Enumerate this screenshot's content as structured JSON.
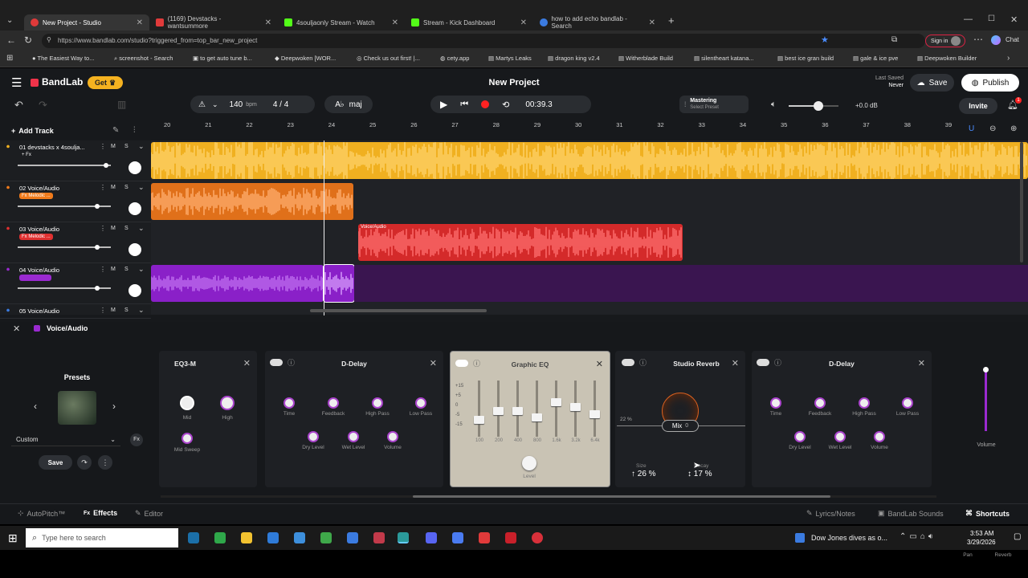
{
  "browser": {
    "tabs": [
      {
        "label": "New Project - Studio",
        "color": "#e03a3a"
      },
      {
        "label": "(1169) Devstacks - wantsummore",
        "color": "#e03a3a"
      },
      {
        "label": "4souljaonly Stream - Watch",
        "color": "#53fc18"
      },
      {
        "label": "Stream - Kick Dashboard",
        "color": "#53fc18"
      },
      {
        "label": "how to add echo bandlab - Search",
        "color": "#3b7be0"
      }
    ],
    "url": "https://www.bandlab.com/studio?triggered_from=top_bar_new_project",
    "sign_in": "Sign in",
    "chat": "Chat",
    "bookmarks": [
      "The Easiest Way to...",
      "screenshot - Search",
      "to get auto tune b...",
      "Deepwoken [WOR...",
      "Check us out first! |...",
      "cety.app",
      "Martys Leaks",
      "dragon king v2.4",
      "Witherblade Build",
      "silentheart katana...",
      "best ice gran build",
      "gale & ice pve",
      "Deepwoken Builder"
    ]
  },
  "app": {
    "logo": "BandLab",
    "get_label": "Get",
    "project_title": "New Project",
    "last_saved_label": "Last Saved",
    "last_saved_value": "Never",
    "save_label": "Save",
    "publish_label": "Publish",
    "invite_label": "Invite",
    "notif_count": "1",
    "bpm": "140",
    "bpm_unit": "bpm",
    "time_sig": "4 / 4",
    "key": "maj",
    "key_prefix": "A♭",
    "time": "00:39.3",
    "mastering_label": "Mastering",
    "mastering_sub": "Select Preset",
    "master_db": "+0.0 dB",
    "master_volume": 0.6,
    "add_track": "Add Track"
  },
  "ruler": [
    "20",
    "21",
    "22",
    "23",
    "24",
    "25",
    "26",
    "27",
    "28",
    "29",
    "30",
    "31",
    "32",
    "33",
    "34",
    "35",
    "36",
    "37",
    "38",
    "39"
  ],
  "tracks": [
    {
      "name": "01  devstacks x 4soulja...",
      "fx": "+ Fx",
      "color": "#f0b020",
      "volume": 0.95
    },
    {
      "name": "02  Voice/Audio",
      "fx": "Fx Melodic ...",
      "color": "#f07a1a",
      "volume": 0.85
    },
    {
      "name": "03  Voice/Audio",
      "fx": "Fx Melodic ...",
      "color": "#e03030",
      "volume": 0.85
    },
    {
      "name": "04  Voice/Audio",
      "fx": "",
      "color": "#9a2ad0",
      "volume": 0.85
    },
    {
      "name": "05  Voice/Audio",
      "fx": "",
      "color": "#3b7be0",
      "volume": 0.85
    }
  ],
  "clip_label": "Voice/Audio",
  "panel": {
    "track_name": "Voice/Audio",
    "presets_title": "Presets",
    "preset_value": "Custom",
    "save_label": "Save",
    "effects": [
      {
        "title": "EQ3-M",
        "knobs": [
          "Mid",
          "High",
          "Mid Sweep"
        ]
      },
      {
        "title": "D-Delay",
        "knobs": [
          "Time",
          "Feedback",
          "High Pass",
          "Low Pass",
          "Dry Level",
          "Wet Level",
          "Volume"
        ]
      },
      {
        "title": "Graphic EQ",
        "db_labels": [
          "+15",
          "+5",
          "0",
          "-5",
          "-15"
        ],
        "bands": [
          "100",
          "200",
          "400",
          "800",
          "1.6k",
          "3.2k",
          "6.4k"
        ],
        "level": "Level"
      },
      {
        "title": "Studio Reverb",
        "pct_left": "22 %",
        "mix": "Mix",
        "mix_value": "0",
        "size_label": "Size",
        "size_value": "26 %",
        "decay_label": "Decay",
        "decay_value": "17 %"
      },
      {
        "title": "D-Delay",
        "knobs": [
          "Time",
          "Feedback",
          "High Pass",
          "Low Pass",
          "Dry Level",
          "Wet Level",
          "Volume"
        ]
      }
    ],
    "volume_label": "Volume",
    "pan_label": "Pan",
    "reverb_label": "Reverb"
  },
  "bottom_nav": {
    "autopitch": "AutoPitch™",
    "effects": "Effects",
    "editor": "Editor",
    "lyrics": "Lyrics/Notes",
    "sounds": "BandLab Sounds",
    "shortcuts": "Shortcuts"
  },
  "taskbar": {
    "search_placeholder": "Type here to search",
    "news": "Dow Jones dives as o...",
    "time": "3:53 AM",
    "date": "3/29/2026"
  }
}
